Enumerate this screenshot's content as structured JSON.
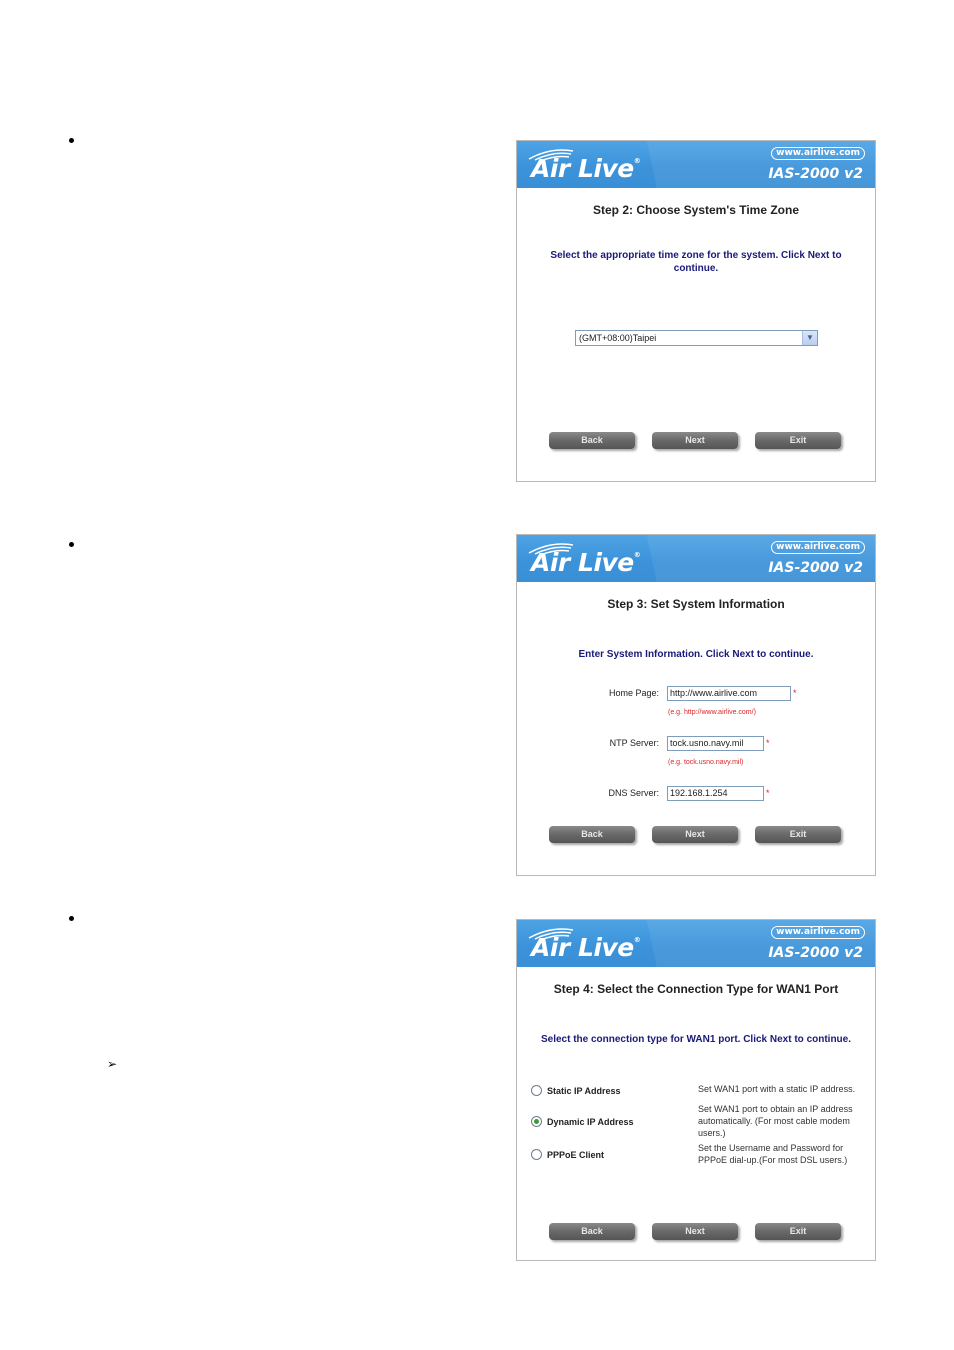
{
  "document": {
    "bullets": 3,
    "sub_arrow": "➢"
  },
  "brand": {
    "logo_text": "Air Live",
    "registered_mark": "®",
    "url": "www.airlive.com",
    "model": "IAS-2000 v2",
    "banner_color": "#3c93da"
  },
  "colors": {
    "instruction_text": "#1a1a7a",
    "required_marker": "#d9262a",
    "button": "#6b6b6b"
  },
  "panels": [
    {
      "title": "Step 2: Choose System's Time Zone",
      "instruction": "Select the appropriate time zone for the system. Click Next to continue.",
      "timezone_select": {
        "selected": "(GMT+08:00)Taipei",
        "dropdown_icon": "▼"
      },
      "buttons": {
        "back": "Back",
        "next": "Next",
        "exit": "Exit"
      }
    },
    {
      "title": "Step 3: Set System Information",
      "instruction": "Enter System Information. Click Next to continue.",
      "fields": [
        {
          "label": "Home Page:",
          "value": "http://www.airlive.com",
          "required": "*",
          "hint": "(e.g. http://www.airlive.com/)"
        },
        {
          "label": "NTP Server:",
          "value": "tock.usno.navy.mil",
          "required": "*",
          "hint": "(e.g. tock.usno.navy.mil)"
        },
        {
          "label": "DNS Server:",
          "value": "192.168.1.254",
          "required": "*",
          "hint": ""
        }
      ],
      "buttons": {
        "back": "Back",
        "next": "Next",
        "exit": "Exit"
      }
    },
    {
      "title": "Step 4: Select the Connection Type for WAN1 Port",
      "instruction": "Select the connection type for WAN1 port. Click Next to continue.",
      "options": [
        {
          "label": "Static IP Address",
          "checked": false,
          "description": "Set WAN1 port with a static IP address."
        },
        {
          "label": "Dynamic IP Address",
          "checked": true,
          "description": "Set WAN1 port to obtain an IP address automatically. (For most cable modem users.)"
        },
        {
          "label": "PPPoE Client",
          "checked": false,
          "description": "Set the Username and Password for PPPoE dial-up.(For most DSL users.)"
        }
      ],
      "buttons": {
        "back": "Back",
        "next": "Next",
        "exit": "Exit"
      }
    }
  ]
}
